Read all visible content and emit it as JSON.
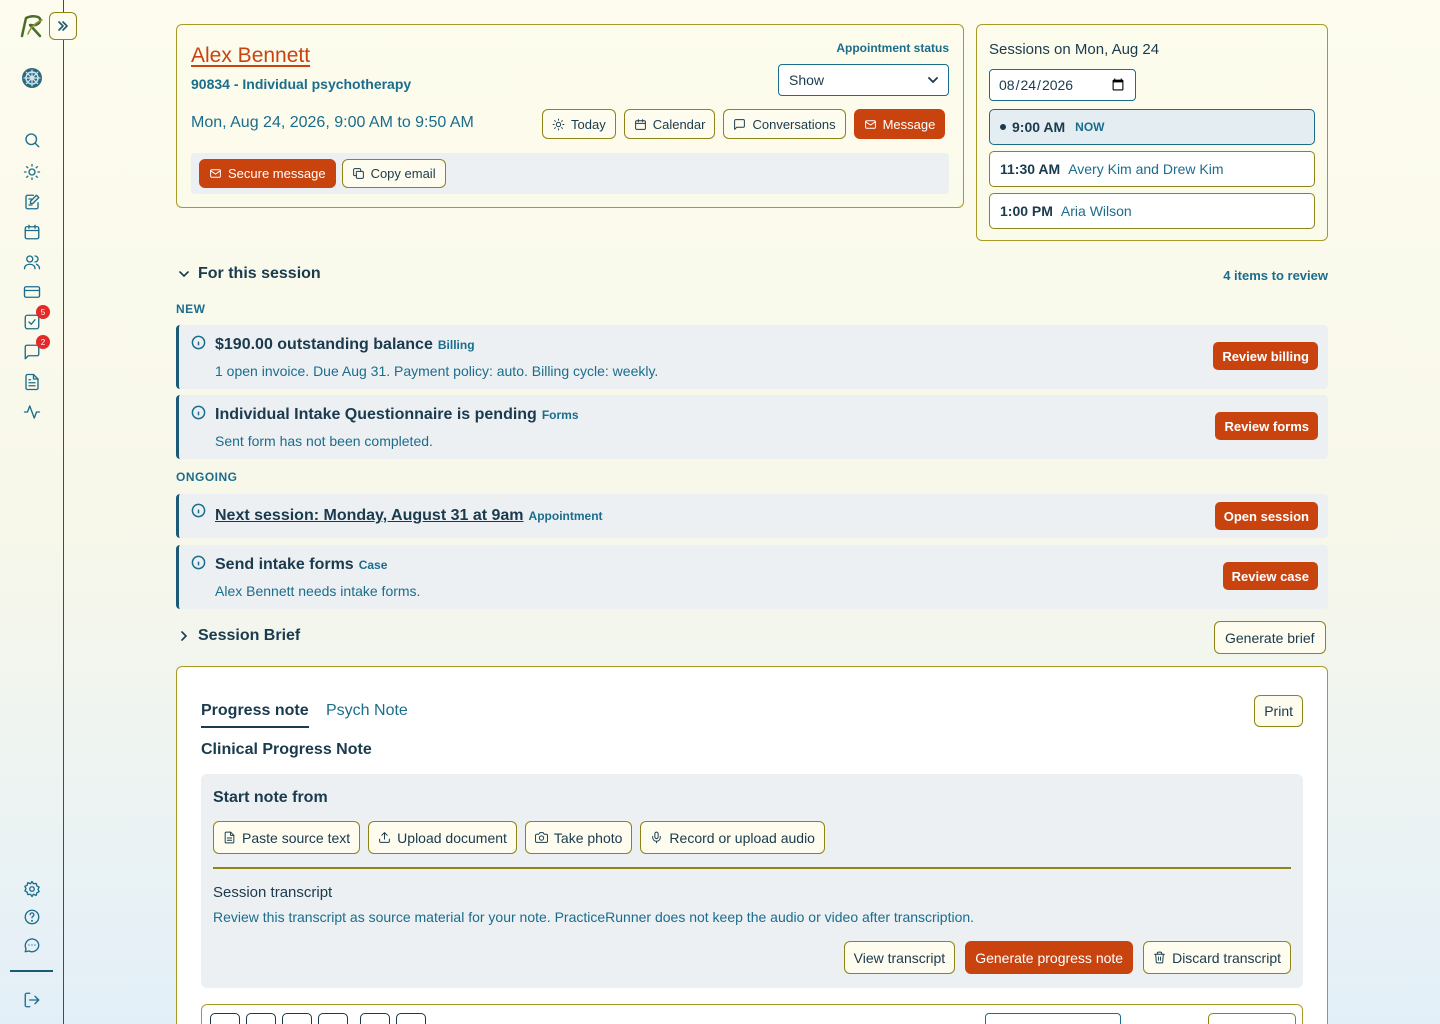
{
  "sidebar": {
    "tasks_badge": "5",
    "messages_badge": "2"
  },
  "client": {
    "name": "Alex Bennett",
    "service": "90834 - Individual psychotherapy",
    "datetime": "Mon, Aug 24, 2026, 9:00 AM to 9:50 AM",
    "appointment_status_label": "Appointment status",
    "appointment_status_value": "Show",
    "appointment_status_options": [
      "Show"
    ],
    "buttons": {
      "today": "Today",
      "calendar": "Calendar",
      "conversations": "Conversations",
      "message": "Message",
      "secure_message": "Secure message",
      "copy_email": "Copy email"
    }
  },
  "sessions": {
    "title": "Sessions on Mon, Aug 24",
    "date_value": "2026-08-24",
    "items": [
      {
        "time": "9:00 AM",
        "label": "NOW"
      },
      {
        "time": "11:30 AM",
        "label": "Avery Kim and Drew Kim"
      },
      {
        "time": "1:00 PM",
        "label": "Aria Wilson"
      }
    ]
  },
  "for_session": {
    "title": "For this session",
    "review_count": "4 items to review",
    "new_label": "NEW",
    "ongoing_label": "ONGOING",
    "items": [
      {
        "title": "$190.00 outstanding balance",
        "tag": "Billing",
        "desc": "1 open invoice. Due Aug 31. Payment policy: auto. Billing cycle: weekly.",
        "action": "Review billing"
      },
      {
        "title": "Individual Intake Questionnaire is pending",
        "tag": "Forms",
        "desc": "Sent form has not been completed.",
        "action": "Review forms"
      },
      {
        "title": "Next session: Monday, August 31 at 9am",
        "tag": "Appointment",
        "desc": "",
        "action": "Open session"
      },
      {
        "title": "Send intake forms",
        "tag": "Case",
        "desc": "Alex Bennett needs intake forms.",
        "action": "Review case"
      }
    ]
  },
  "session_brief": {
    "title": "Session Brief",
    "generate": "Generate brief"
  },
  "note": {
    "tabs": [
      "Progress note",
      "Psych Note"
    ],
    "print": "Print",
    "heading": "Clinical Progress Note",
    "start_from": "Start note from",
    "sources": [
      "Paste source text",
      "Upload document",
      "Take photo",
      "Record or upload audio"
    ],
    "transcript_title": "Session transcript",
    "transcript_desc": "Review this transcript as source material for your note. PracticeRunner does not keep the audio or video after transcription.",
    "view_transcript": "View transcript",
    "generate_note": "Generate progress note",
    "discard_transcript": "Discard transcript"
  },
  "colors": {
    "accent": "#c9430f",
    "primary_text": "#1a3a4d",
    "link": "#1b6d8c",
    "border": "#a89b25"
  }
}
